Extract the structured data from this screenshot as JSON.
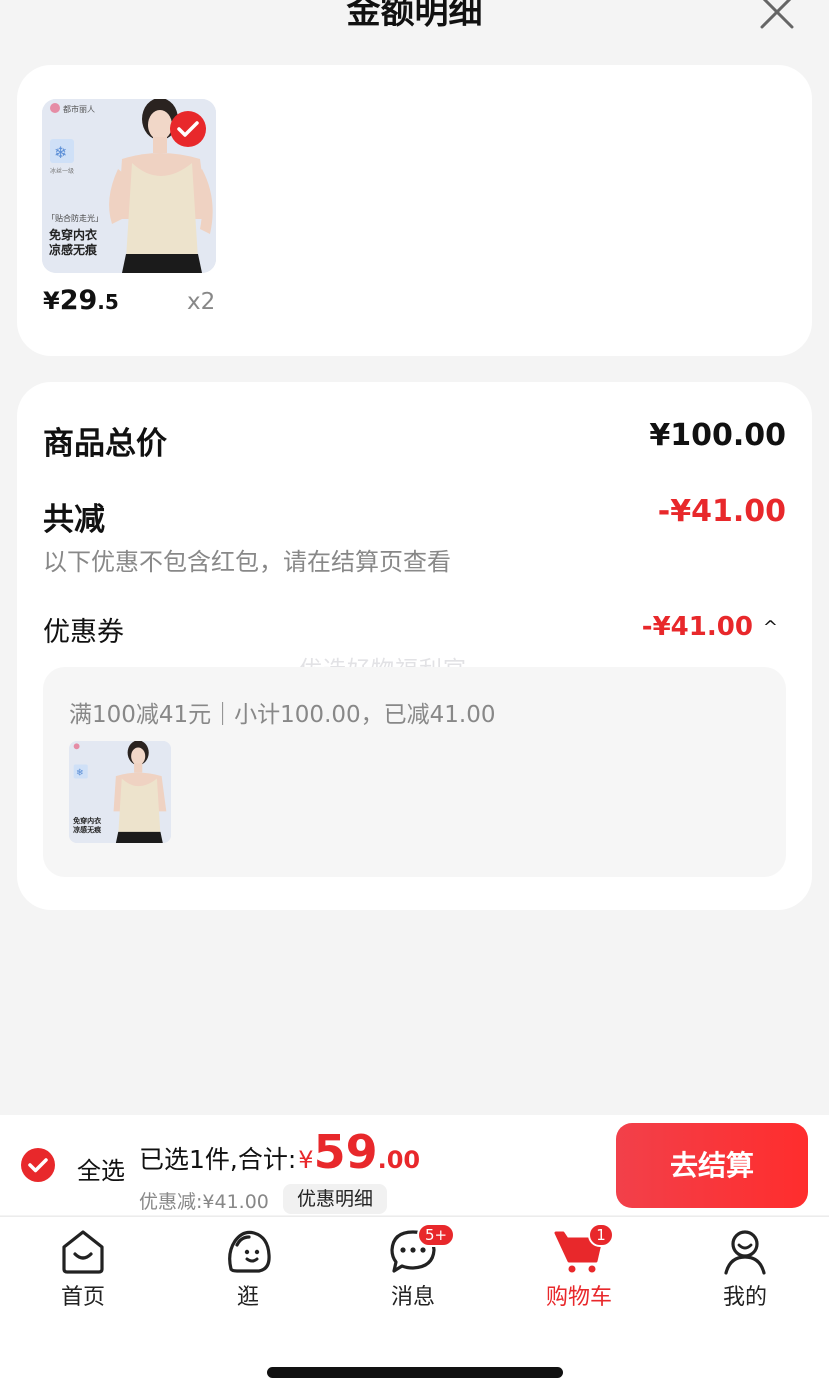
{
  "header": {
    "title": "金额明细",
    "close_icon": "close-icon"
  },
  "product": {
    "image_icon": "product-thumbnail",
    "image_brand": "都市丽人",
    "image_caption_tag": "「贴合防走光」",
    "image_caption_line1": "免穿内衣",
    "image_caption_line2": "凉感无痕",
    "image_badge": "冰丝一级",
    "price_currency": "¥",
    "price_int": "29",
    "price_dec": ".5",
    "quantity": "x2"
  },
  "summary": {
    "total_label": "商品总价",
    "total_value": "¥100.00",
    "reduce_label": "共减",
    "reduce_value": "-¥41.00",
    "note": "以下优惠不包含红包，请在结算页查看",
    "coupon_label": "优惠券",
    "coupon_value": "-¥41.00",
    "coupon_caret": "^",
    "watermark": "优选好物福利官",
    "coupon_detail": "满100减41元｜小计100.00，已减41.00"
  },
  "bottom_bar": {
    "select_all": "全选",
    "selected_label": "已选1件,合计:",
    "total_currency": "¥",
    "total_int": "59",
    "total_dec": ".00",
    "discount_text": "优惠减:¥41.00",
    "detail_button": "优惠明细",
    "checkout_button": "去结算"
  },
  "tabbar": {
    "items": [
      {
        "label": "首页",
        "icon": "home-icon"
      },
      {
        "label": "逛",
        "icon": "explore-icon"
      },
      {
        "label": "消息",
        "icon": "message-icon",
        "badge": "5+"
      },
      {
        "label": "购物车",
        "icon": "cart-icon",
        "badge": "1",
        "active": true
      },
      {
        "label": "我的",
        "icon": "profile-icon"
      }
    ]
  },
  "colors": {
    "accent": "#e8282b",
    "background": "#f4f4f4",
    "card": "#ffffff",
    "muted_text": "#888888"
  }
}
